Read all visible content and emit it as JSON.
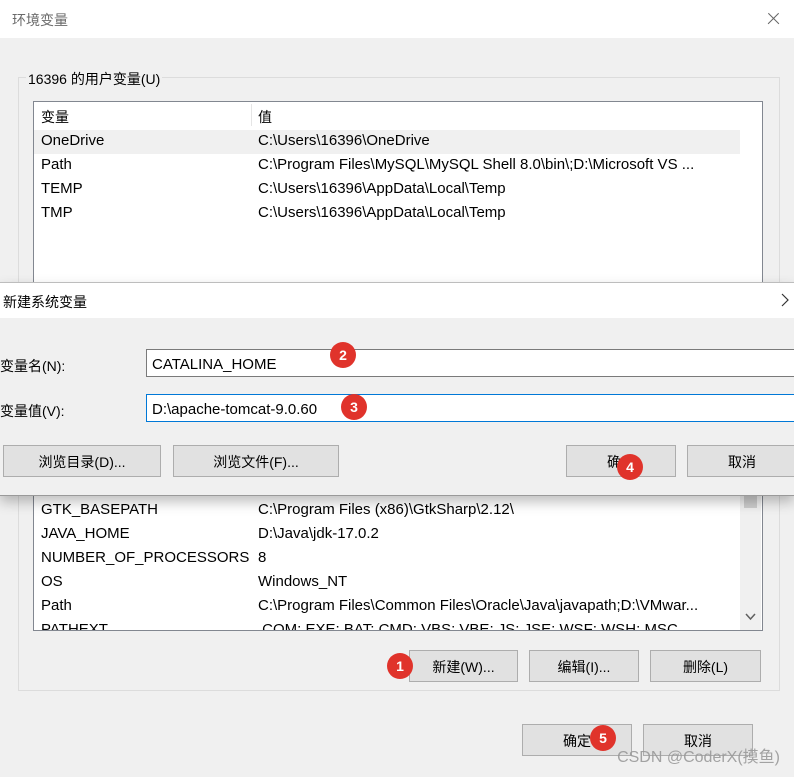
{
  "env_window": {
    "title": "环境变量",
    "user_vars": {
      "group_label": "16396 的用户变量(U)",
      "headers": {
        "name": "变量",
        "value": "值"
      },
      "rows": [
        {
          "name": "OneDrive",
          "value": "C:\\Users\\16396\\OneDrive"
        },
        {
          "name": "Path",
          "value": "C:\\Program Files\\MySQL\\MySQL Shell 8.0\\bin\\;D:\\Microsoft VS ..."
        },
        {
          "name": "TEMP",
          "value": "C:\\Users\\16396\\AppData\\Local\\Temp"
        },
        {
          "name": "TMP",
          "value": "C:\\Users\\16396\\AppData\\Local\\Temp"
        }
      ]
    },
    "system_vars": {
      "rows": [
        {
          "name": "GTK_BASEPATH",
          "value": "C:\\Program Files (x86)\\GtkSharp\\2.12\\"
        },
        {
          "name": "JAVA_HOME",
          "value": "D:\\Java\\jdk-17.0.2"
        },
        {
          "name": "NUMBER_OF_PROCESSORS",
          "value": "8"
        },
        {
          "name": "OS",
          "value": "Windows_NT"
        },
        {
          "name": "Path",
          "value": "C:\\Program Files\\Common Files\\Oracle\\Java\\javapath;D:\\VMwar..."
        },
        {
          "name": "PATHEXT",
          "value": ".COM;.EXE;.BAT;.CMD;.VBS;.VBE;.JS;.JSE;.WSF;.WSH;.MSC"
        }
      ],
      "buttons": {
        "new": "新建(W)...",
        "edit": "编辑(I)...",
        "delete": "删除(L)"
      }
    },
    "footer_buttons": {
      "ok": "确定",
      "cancel": "取消"
    }
  },
  "new_var_dialog": {
    "title": "新建系统变量",
    "name_label": "变量名(N):",
    "name_value": "CATALINA_HOME",
    "value_label": "变量值(V):",
    "value_value": "D:\\apache-tomcat-9.0.60",
    "buttons": {
      "browse_dir": "浏览目录(D)...",
      "browse_file": "浏览文件(F)...",
      "ok": "确定",
      "cancel": "取消"
    }
  },
  "step_badges": [
    "1",
    "2",
    "3",
    "4",
    "5"
  ],
  "watermark": "CSDN @CoderX(摸鱼)",
  "colors": {
    "badge": "#e0332b",
    "focus_border": "#0078d7",
    "window_bg": "#f0f0f0"
  }
}
